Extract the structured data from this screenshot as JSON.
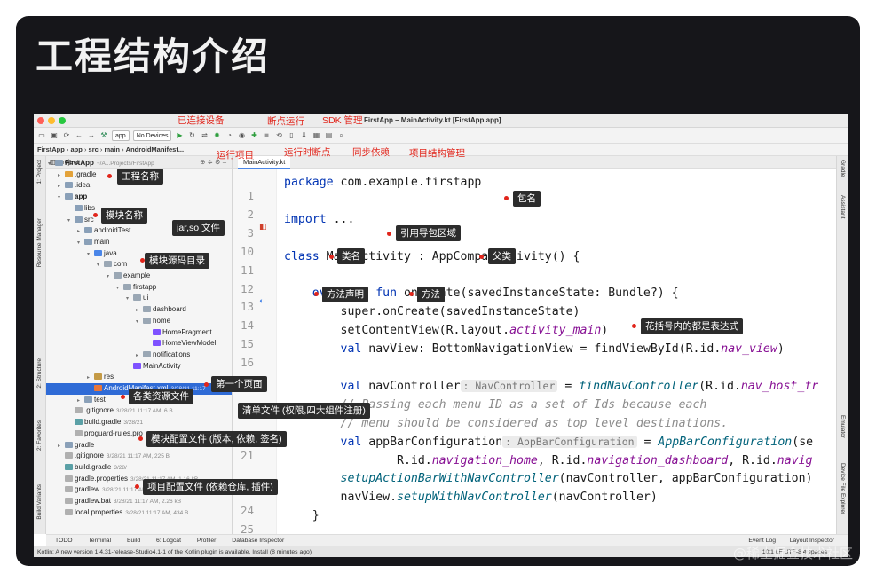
{
  "slide_title": "工程结构介绍",
  "window": {
    "title": "FirstApp – MainActivity.kt [FirstApp.app]",
    "colors": {
      "close": "#ff5f57",
      "minimize": "#febc2e",
      "zoom": "#28c840"
    }
  },
  "toolbar": {
    "module_combo": "app",
    "device_combo": "No Devices"
  },
  "breadcrumb": [
    "FirstApp",
    "app",
    "src",
    "main",
    "AndroidManifest..."
  ],
  "project_panel": {
    "title": "Project",
    "rows": [
      {
        "text": "FirstApp",
        "meta": "~/A...Projects/FirstApp",
        "depth": 0,
        "arrow": "▾",
        "icon": "folder",
        "bold": true
      },
      {
        "text": ".gradle",
        "depth": 1,
        "arrow": "▸",
        "icon": "folder-orange"
      },
      {
        "text": ".idea",
        "depth": 1,
        "arrow": "▸",
        "icon": "folder"
      },
      {
        "text": "app",
        "depth": 1,
        "arrow": "▾",
        "icon": "folder",
        "bold": true
      },
      {
        "text": "libs",
        "depth": 2,
        "arrow": "",
        "icon": "folder"
      },
      {
        "text": "src",
        "depth": 2,
        "arrow": "▾",
        "icon": "folder"
      },
      {
        "text": "androidTest",
        "depth": 3,
        "arrow": "▸",
        "icon": "folder"
      },
      {
        "text": "main",
        "depth": 3,
        "arrow": "▾",
        "icon": "folder"
      },
      {
        "text": "java",
        "depth": 4,
        "arrow": "▾",
        "icon": "folder-blue"
      },
      {
        "text": "com",
        "depth": 5,
        "arrow": "▾",
        "icon": "package"
      },
      {
        "text": "example",
        "depth": 6,
        "arrow": "▾",
        "icon": "package"
      },
      {
        "text": "firstapp",
        "depth": 7,
        "arrow": "▾",
        "icon": "package"
      },
      {
        "text": "ui",
        "depth": 8,
        "arrow": "▾",
        "icon": "package"
      },
      {
        "text": "dashboard",
        "depth": 9,
        "arrow": "▸",
        "icon": "package"
      },
      {
        "text": "home",
        "depth": 9,
        "arrow": "▾",
        "icon": "package"
      },
      {
        "text": "HomeFragment",
        "depth": 10,
        "arrow": "",
        "icon": "kotlin"
      },
      {
        "text": "HomeViewModel",
        "depth": 10,
        "arrow": "",
        "icon": "kotlin"
      },
      {
        "text": "notifications",
        "depth": 9,
        "arrow": "▸",
        "icon": "package"
      },
      {
        "text": "MainActivity",
        "depth": 8,
        "arrow": "",
        "icon": "kotlin"
      },
      {
        "text": "res",
        "depth": 4,
        "arrow": "▸",
        "icon": "folder-res"
      },
      {
        "text": "AndroidManifest.xml",
        "meta": "3/28/21 11:17",
        "depth": 4,
        "arrow": "",
        "icon": "xml",
        "selected": true
      },
      {
        "text": "test",
        "depth": 3,
        "arrow": "▸",
        "icon": "folder"
      },
      {
        "text": ".gitignore",
        "meta": "3/28/21 11:17 AM, 6 B",
        "depth": 2,
        "arrow": "",
        "icon": "file"
      },
      {
        "text": "build.gradle",
        "meta": "3/28/21",
        "depth": 2,
        "arrow": "",
        "icon": "gradle"
      },
      {
        "text": "proguard-rules.pro",
        "meta": "3/28/21 11:17 AM, 750",
        "depth": 2,
        "arrow": "",
        "icon": "file"
      },
      {
        "text": "gradle",
        "depth": 1,
        "arrow": "▸",
        "icon": "folder"
      },
      {
        "text": ".gitignore",
        "meta": "3/28/21 11:17 AM, 225 B",
        "depth": 1,
        "arrow": "",
        "icon": "file"
      },
      {
        "text": "build.gradle",
        "meta": "3/28/",
        "depth": 1,
        "arrow": "",
        "icon": "gradle"
      },
      {
        "text": "gradle.properties",
        "meta": "3/28/21 11:17 AM, 1.16 kB",
        "depth": 1,
        "arrow": "",
        "icon": "file"
      },
      {
        "text": "gradlew",
        "meta": "3/28/21 11:17 AM, 5.3 kB",
        "depth": 1,
        "arrow": "",
        "icon": "file"
      },
      {
        "text": "gradlew.bat",
        "meta": "3/28/21 11:17 AM, 2.26 kB",
        "depth": 1,
        "arrow": "",
        "icon": "file"
      },
      {
        "text": "local.properties",
        "meta": "3/28/21 11:17 AM, 434 B",
        "depth": 1,
        "arrow": "",
        "icon": "file"
      }
    ]
  },
  "editor": {
    "tab": "MainActivity.kt",
    "line_numbers": [
      "1",
      "2",
      "3",
      "10",
      "11",
      "12",
      "13",
      "14",
      "15",
      "16",
      "",
      "",
      "",
      "",
      "21",
      "",
      "",
      "24",
      "25"
    ],
    "code": [
      [
        [
          "kw",
          "package "
        ],
        [
          "",
          "com.example.firstapp"
        ]
      ],
      [],
      [
        [
          "kw",
          "import "
        ],
        [
          "",
          "..."
        ]
      ],
      [],
      [
        [
          "kw",
          "class "
        ],
        [
          "",
          "MainActivity : AppCompatActivity() {"
        ]
      ],
      [],
      [
        [
          "",
          "    "
        ],
        [
          "kw",
          "override fun "
        ],
        [
          "",
          "onCreate(savedInstanceState: Bundle?) {"
        ]
      ],
      [
        [
          "",
          "        super.onCreate(savedInstanceState)"
        ]
      ],
      [
        [
          "",
          "        setContentView(R.layout."
        ],
        [
          "it",
          "activity_main"
        ],
        [
          "",
          ")"
        ]
      ],
      [
        [
          "",
          "        "
        ],
        [
          "kw",
          "val "
        ],
        [
          "",
          "navView: BottomNavigationView = findViewById(R.id."
        ],
        [
          "it",
          "nav_view"
        ],
        [
          "",
          ")"
        ]
      ],
      [],
      [
        [
          "",
          "        "
        ],
        [
          "kw",
          "val "
        ],
        [
          "",
          "navController"
        ],
        [
          "hint",
          ": NavController"
        ],
        [
          "",
          " = "
        ],
        [
          "fn",
          "findNavController"
        ],
        [
          "",
          "(R.id."
        ],
        [
          "it",
          "nav_host_fr"
        ]
      ],
      [
        [
          "cm",
          "        // Passing each menu ID as a set of Ids because each"
        ]
      ],
      [
        [
          "cm",
          "        // menu should be considered as top level destinations."
        ]
      ],
      [
        [
          "",
          "        "
        ],
        [
          "kw",
          "val "
        ],
        [
          "",
          "appBarConfiguration"
        ],
        [
          "hint",
          ": AppBarConfiguration"
        ],
        [
          "",
          " = "
        ],
        [
          "fn",
          "AppBarConfiguration"
        ],
        [
          "",
          "(se"
        ]
      ],
      [
        [
          "",
          "                R.id."
        ],
        [
          "it",
          "navigation_home"
        ],
        [
          "",
          ", R.id."
        ],
        [
          "it",
          "navigation_dashboard"
        ],
        [
          "",
          ", R.id."
        ],
        [
          "it",
          "navig"
        ]
      ],
      [
        [
          "",
          "        "
        ],
        [
          "fn",
          "setupActionBarWithNavController"
        ],
        [
          "",
          "(navController, appBarConfiguration)"
        ]
      ],
      [
        [
          "",
          "        navView."
        ],
        [
          "fn",
          "setupWithNavController"
        ],
        [
          "",
          "(navController)"
        ]
      ],
      [
        [
          "",
          "    }"
        ]
      ]
    ]
  },
  "left_strip": [
    "1: Project",
    "Resource Manager",
    "2: Structure",
    "2: Favorites",
    "Build Variants"
  ],
  "right_strip": [
    "Gradle",
    "Assistant",
    "Emulator",
    "Device File Explorer"
  ],
  "bottom_tools": [
    "TODO",
    "Terminal",
    "Build",
    "6: Logcat",
    "Profiler",
    "Database Inspector"
  ],
  "bottom_tools_right": [
    "Event Log",
    "Layout Inspector"
  ],
  "status": {
    "message": "Kotlin: A new version 1.4.31-release-Studio4.1-1 of the Kotlin plugin is available. Install (8 minutes ago)",
    "right": "10:1  LF  UTF-8  4 spaces"
  },
  "annotations": {
    "connected_device": "已连接设备",
    "breakpoint_run": "断点运行",
    "sdk_manager": "SDK 管理",
    "run_project": "运行项目",
    "runtime_breakpoint": "运行时断点",
    "sync_deps": "同步依赖",
    "project_structure": "项目结构管理",
    "project_name": "工程名称",
    "module_name": "模块名称",
    "jar_so": "jar,so 文件",
    "module_source": "模块源码目录",
    "first_page": "第一个页面",
    "resources": "各类资源文件",
    "manifest": "清单文件 (权限,四大组件注册)",
    "module_config": "模块配置文件 (版本, 依赖, 签名)",
    "project_config": "项目配置文件 (依赖仓库, 插件)",
    "package_name": "包名",
    "import_area": "引用导包区域",
    "class_name": "类名",
    "parent_class": "父类",
    "method_decl": "方法声明",
    "method": "方法",
    "expressions": "花括号内的都是表达式"
  },
  "watermark": "@稀土掘金技术社区"
}
